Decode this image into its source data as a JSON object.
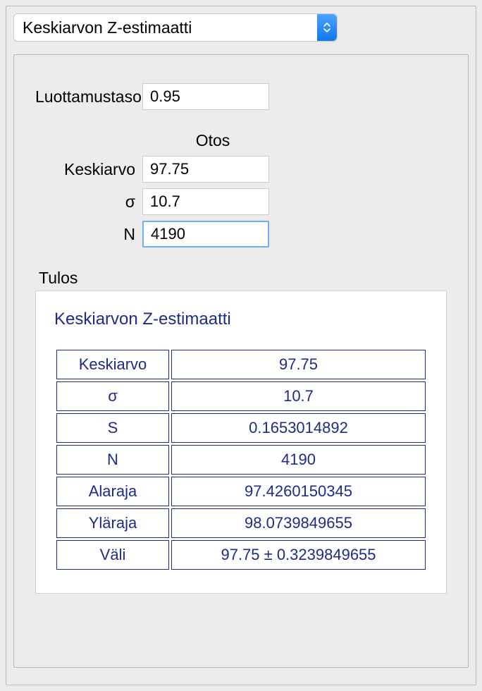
{
  "dropdown": {
    "selected": "Keskiarvon Z-estimaatti"
  },
  "form": {
    "confidence_label": "Luottamustaso",
    "confidence_value": "0.95",
    "sample_header": "Otos",
    "mean_label": "Keskiarvo",
    "mean_value": "97.75",
    "sigma_label": "σ",
    "sigma_value": "10.7",
    "n_label": "N",
    "n_value": "4190"
  },
  "result": {
    "section_label": "Tulos",
    "title": "Keskiarvon Z-estimaatti",
    "rows": [
      {
        "label": "Keskiarvo",
        "value": "97.75"
      },
      {
        "label": "σ",
        "value": "10.7"
      },
      {
        "label": "S",
        "value": "0.1653014892"
      },
      {
        "label": "N",
        "value": "4190"
      },
      {
        "label": "Alaraja",
        "value": "97.4260150345"
      },
      {
        "label": "Yläraja",
        "value": "98.0739849655"
      },
      {
        "label": "Väli",
        "value": "97.75 ± 0.3239849655"
      }
    ]
  }
}
